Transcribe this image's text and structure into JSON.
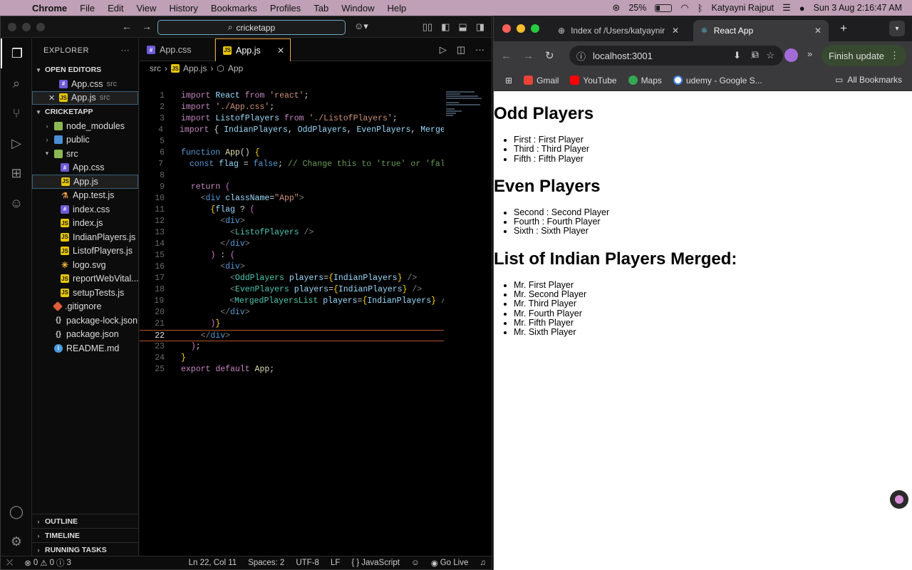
{
  "menubar": {
    "app": "Chrome",
    "items": [
      "File",
      "Edit",
      "View",
      "History",
      "Bookmarks",
      "Profiles",
      "Tab",
      "Window",
      "Help"
    ],
    "battery": "25%",
    "user": "Katyayni Rajput",
    "datetime": "Sun 3 Aug  2:16:47 AM"
  },
  "vscode": {
    "command_center": "cricketapp",
    "explorer_title": "EXPLORER",
    "open_editors_title": "OPEN EDITORS",
    "open_editors": [
      {
        "name": "App.css",
        "desc": "src",
        "type": "css"
      },
      {
        "name": "App.js",
        "desc": "src",
        "type": "js"
      }
    ],
    "project_title": "CRICKETAPP",
    "tree": [
      {
        "name": "node_modules",
        "type": "folder",
        "depth": 1
      },
      {
        "name": "public",
        "type": "folder-blue",
        "depth": 1
      },
      {
        "name": "src",
        "type": "folder",
        "depth": 1
      },
      {
        "name": "App.css",
        "type": "css",
        "depth": 2
      },
      {
        "name": "App.js",
        "type": "js",
        "depth": 2
      },
      {
        "name": "App.test.js",
        "type": "test",
        "depth": 2
      },
      {
        "name": "index.css",
        "type": "css",
        "depth": 2
      },
      {
        "name": "index.js",
        "type": "js",
        "depth": 2
      },
      {
        "name": "IndianPlayers.js",
        "type": "js",
        "depth": 2
      },
      {
        "name": "ListofPlayers.js",
        "type": "js",
        "depth": 2
      },
      {
        "name": "logo.svg",
        "type": "svg",
        "depth": 2
      },
      {
        "name": "reportWebVital...",
        "type": "js",
        "depth": 2
      },
      {
        "name": "setupTests.js",
        "type": "js",
        "depth": 2
      },
      {
        "name": ".gitignore",
        "type": "git",
        "depth": 1
      },
      {
        "name": "package-lock.json",
        "type": "json",
        "depth": 1
      },
      {
        "name": "package.json",
        "type": "json",
        "depth": 1
      },
      {
        "name": "README.md",
        "type": "info",
        "depth": 1
      }
    ],
    "bottom_sections": [
      "OUTLINE",
      "TIMELINE",
      "RUNNING TASKS"
    ],
    "tabs": [
      {
        "name": "App.css",
        "type": "css"
      },
      {
        "name": "App.js",
        "type": "js"
      }
    ],
    "breadcrumb": [
      "src",
      "App.js",
      "App"
    ],
    "current_line": 22,
    "status": {
      "errors": "0",
      "warnings": "0",
      "info": "3",
      "position": "Ln 22, Col 11",
      "spaces": "Spaces: 2",
      "encoding": "UTF-8",
      "eol": "LF",
      "language": "JavaScript",
      "golive": "Go Live"
    }
  },
  "chrome": {
    "tab1": "Index of /Users/katyaynir",
    "tab2": "React App",
    "url": "localhost:3001",
    "finish_update": "Finish update",
    "bookmarks": [
      "Gmail",
      "YouTube",
      "Maps",
      "udemy - Google S..."
    ],
    "all_bookmarks": "All Bookmarks"
  },
  "page": {
    "sections": [
      {
        "title": "Odd Players",
        "items": [
          "First : First Player",
          "Third : Third Player",
          "Fifth : Fifth Player"
        ]
      },
      {
        "title": "Even Players",
        "items": [
          "Second : Second Player",
          "Fourth : Fourth Player",
          "Sixth : Sixth Player"
        ]
      },
      {
        "title": "List of Indian Players Merged:",
        "items": [
          "Mr. First Player",
          "Mr. Second Player",
          "Mr. Third Player",
          "Mr. Fourth Player",
          "Mr. Fifth Player",
          "Mr. Sixth Player"
        ]
      }
    ]
  }
}
